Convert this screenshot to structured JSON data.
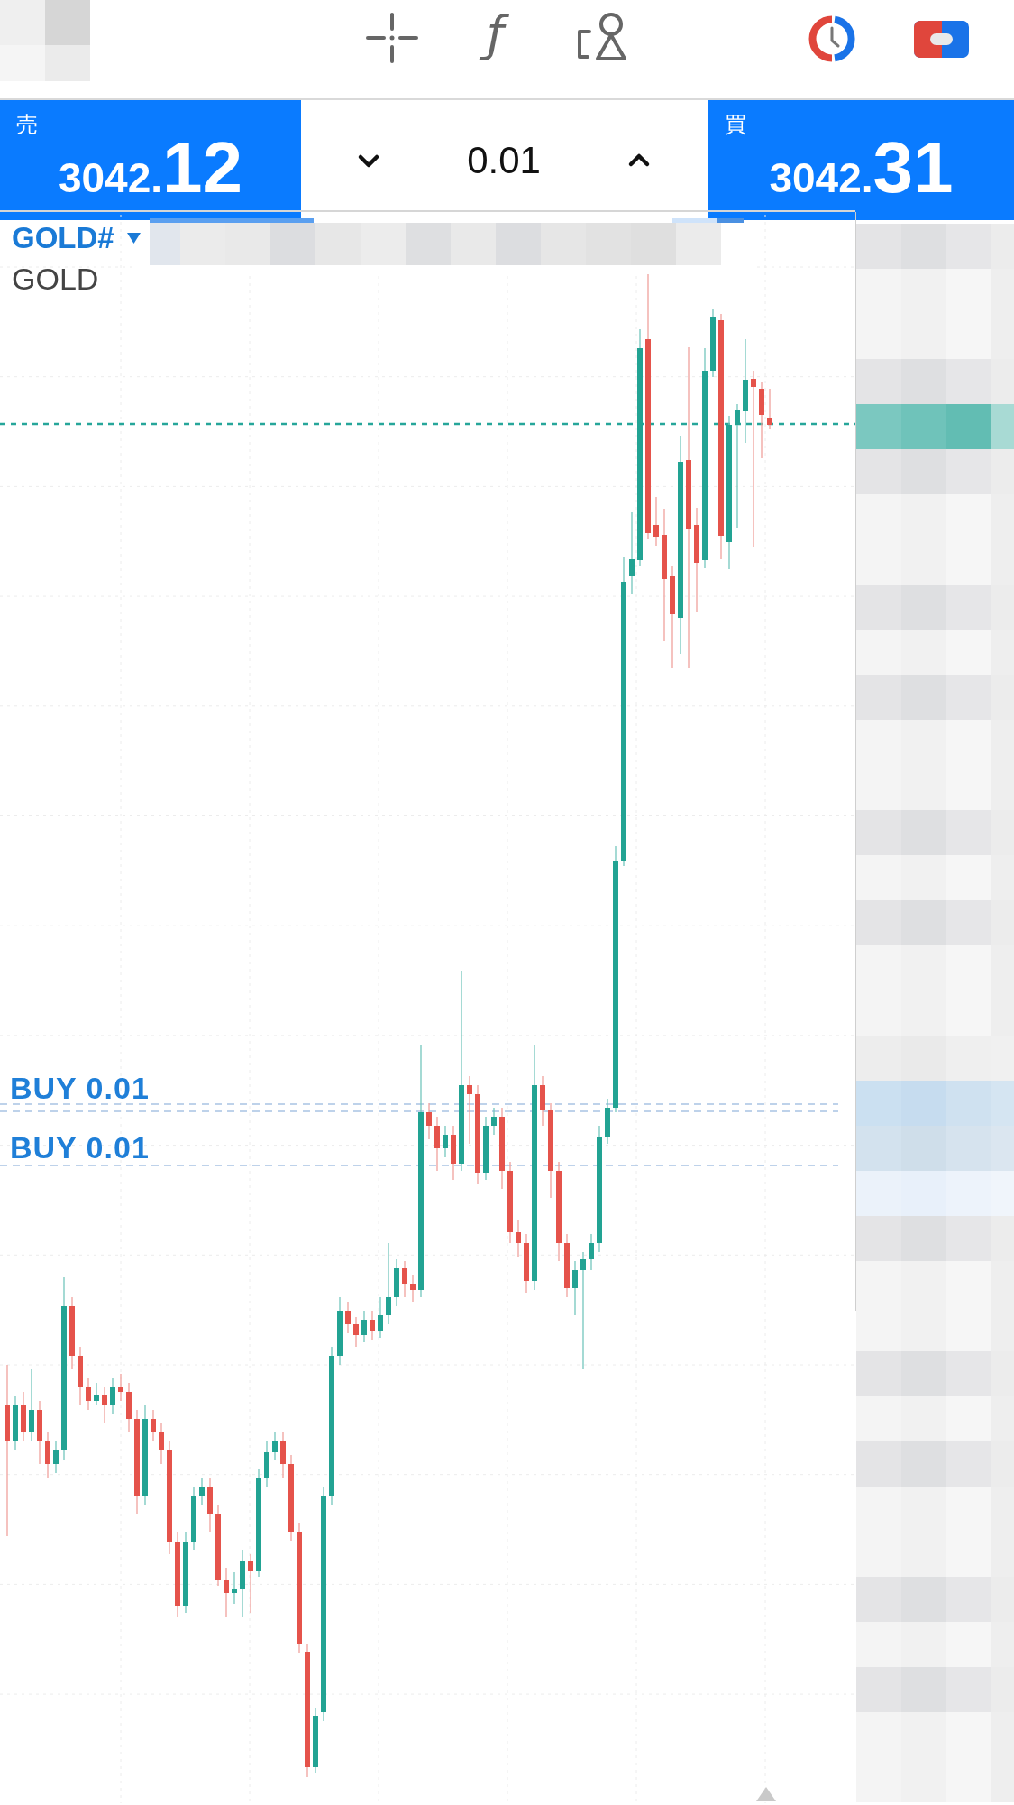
{
  "toolbar": {
    "indicator_glyph": "ƒ"
  },
  "trade_bar": {
    "sell": {
      "label": "売",
      "price": "3042.",
      "price_large": "12"
    },
    "volume": "0.01",
    "buy": {
      "label": "買",
      "price": "3042.",
      "price_large": "31"
    }
  },
  "chart": {
    "symbol": "GOLD#",
    "description": "GOLD",
    "order_labels": [
      {
        "label": "BUY 0.01"
      },
      {
        "label": "BUY 0.01"
      }
    ]
  }
}
